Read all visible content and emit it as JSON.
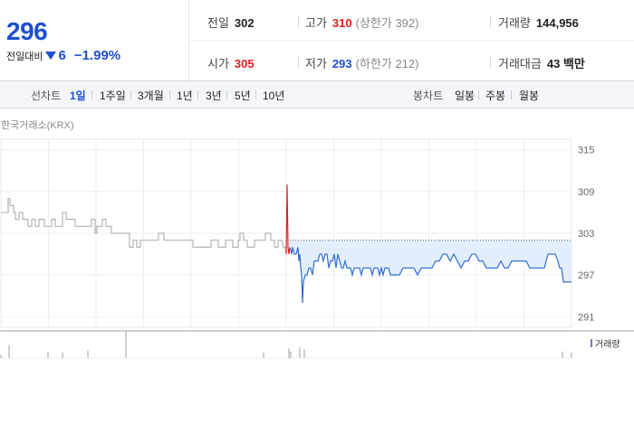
{
  "quote": {
    "price": "296",
    "change_label": "전일대비",
    "change_amount": "6",
    "change_rate": "−1.99%",
    "stats": [
      {
        "label": "전일",
        "value": "302",
        "sub": "",
        "tone": ""
      },
      {
        "label": "고가",
        "value": "310",
        "sub": "(상한가 392)",
        "tone": "up"
      },
      {
        "label": "거래량",
        "value": "144,956",
        "sub": "",
        "tone": ""
      },
      {
        "label": "시가",
        "value": "305",
        "sub": "",
        "tone": "up"
      },
      {
        "label": "저가",
        "value": "293",
        "sub": "(하한가 212)",
        "tone": "down"
      },
      {
        "label": "거래대금",
        "value": "43 백만",
        "sub": "",
        "tone": ""
      }
    ]
  },
  "periods": {
    "line_label": "선차트",
    "line_tabs": [
      "1일",
      "1주일",
      "3개월",
      "1년",
      "3년",
      "5년",
      "10년"
    ],
    "active": "1일",
    "candle_label": "봉차트",
    "candle_tabs": [
      "일봉",
      "주봉",
      "월봉"
    ]
  },
  "chart": {
    "exchange": "한국거래소(KRX)",
    "volume_legend": "거래량"
  },
  "chart_data": {
    "type": "line",
    "ylim": [
      290,
      316
    ],
    "y_ticks": [
      315,
      309,
      303,
      297,
      291
    ],
    "reference_price": 302,
    "series": [
      {
        "points": [
          [
            0,
            306
          ],
          [
            8,
            306
          ],
          [
            8,
            308
          ],
          [
            10,
            308
          ],
          [
            10,
            307
          ],
          [
            14,
            307
          ],
          [
            14,
            306
          ],
          [
            16,
            306
          ],
          [
            16,
            305
          ],
          [
            20,
            305
          ],
          [
            20,
            306
          ],
          [
            24,
            306
          ],
          [
            24,
            305
          ],
          [
            30,
            305
          ],
          [
            30,
            304
          ],
          [
            34,
            304
          ],
          [
            34,
            305
          ],
          [
            38,
            305
          ],
          [
            38,
            304
          ],
          [
            42,
            304
          ],
          [
            42,
            305
          ],
          [
            48,
            305
          ],
          [
            48,
            304
          ],
          [
            56,
            304
          ],
          [
            56,
            305
          ],
          [
            60,
            305
          ],
          [
            60,
            304
          ],
          [
            68,
            304
          ],
          [
            68,
            306
          ],
          [
            72,
            306
          ],
          [
            72,
            305
          ],
          [
            82,
            305
          ],
          [
            82,
            304
          ],
          [
            100,
            304
          ],
          [
            100,
            305
          ],
          [
            104,
            305
          ],
          [
            104,
            303
          ],
          [
            106,
            303
          ],
          [
            106,
            304
          ],
          [
            112,
            304
          ],
          [
            112,
            305
          ],
          [
            116,
            305
          ],
          [
            116,
            304
          ],
          [
            122,
            304
          ],
          [
            122,
            303
          ],
          [
            142,
            303
          ],
          [
            142,
            301
          ],
          [
            146,
            301
          ],
          [
            146,
            302
          ],
          [
            150,
            302
          ],
          [
            150,
            301
          ],
          [
            154,
            301
          ],
          [
            154,
            302
          ],
          [
            174,
            302
          ],
          [
            174,
            303
          ],
          [
            180,
            303
          ],
          [
            180,
            302
          ],
          [
            212,
            302
          ],
          [
            212,
            301
          ],
          [
            232,
            301
          ],
          [
            232,
            302
          ],
          [
            240,
            302
          ],
          [
            240,
            301
          ],
          [
            248,
            301
          ],
          [
            248,
            302
          ],
          [
            256,
            302
          ],
          [
            256,
            301
          ],
          [
            262,
            301
          ],
          [
            262,
            302
          ],
          [
            264,
            302
          ],
          [
            264,
            303
          ],
          [
            268,
            303
          ],
          [
            268,
            302
          ],
          [
            272,
            302
          ],
          [
            272,
            301
          ],
          [
            280,
            301
          ],
          [
            280,
            302
          ],
          [
            292,
            302
          ],
          [
            292,
            303
          ],
          [
            298,
            303
          ],
          [
            298,
            302
          ],
          [
            302,
            302
          ],
          [
            302,
            301
          ],
          [
            306,
            301
          ],
          [
            306,
            302
          ],
          [
            310,
            302
          ],
          [
            312,
            301
          ],
          [
            314,
            301
          ],
          [
            315,
            300
          ]
        ],
        "color": "#b3b3b3"
      },
      {
        "points": [
          [
            315,
            300
          ],
          [
            316,
            310
          ],
          [
            317,
            301
          ],
          [
            318,
            300
          ],
          [
            319,
            301
          ]
        ],
        "color": "#e02020"
      },
      {
        "points": [
          [
            319,
            301
          ],
          [
            321,
            300
          ],
          [
            322,
            301
          ],
          [
            324,
            300
          ],
          [
            326,
            300
          ],
          [
            328,
            301
          ],
          [
            329,
            299
          ],
          [
            330,
            300
          ],
          [
            331,
            298
          ],
          [
            332,
            297
          ],
          [
            333,
            293
          ],
          [
            334,
            296
          ],
          [
            336,
            297
          ],
          [
            338,
            297
          ],
          [
            340,
            298
          ],
          [
            342,
            298
          ],
          [
            344,
            297
          ],
          [
            346,
            299
          ],
          [
            348,
            299
          ],
          [
            350,
            299
          ],
          [
            352,
            300
          ],
          [
            354,
            300
          ],
          [
            356,
            299
          ],
          [
            358,
            300
          ],
          [
            360,
            300
          ],
          [
            362,
            298
          ],
          [
            364,
            299
          ],
          [
            366,
            299
          ],
          [
            368,
            300
          ],
          [
            370,
            298
          ],
          [
            372,
            300
          ],
          [
            374,
            299
          ],
          [
            376,
            298
          ],
          [
            378,
            298
          ],
          [
            380,
            299
          ],
          [
            382,
            298
          ],
          [
            384,
            298
          ],
          [
            386,
            298
          ],
          [
            388,
            297
          ],
          [
            390,
            298
          ],
          [
            392,
            298
          ],
          [
            396,
            298
          ],
          [
            398,
            297
          ],
          [
            400,
            298
          ],
          [
            402,
            298
          ],
          [
            404,
            298
          ],
          [
            406,
            298
          ],
          [
            408,
            298
          ],
          [
            410,
            297
          ],
          [
            412,
            298
          ],
          [
            414,
            298
          ],
          [
            416,
            298
          ],
          [
            418,
            297
          ],
          [
            420,
            298
          ],
          [
            422,
            297
          ],
          [
            424,
            298
          ],
          [
            426,
            298
          ],
          [
            428,
            298
          ],
          [
            430,
            297
          ],
          [
            432,
            297
          ],
          [
            436,
            297
          ],
          [
            440,
            297
          ],
          [
            444,
            298
          ],
          [
            448,
            298
          ],
          [
            452,
            298
          ],
          [
            456,
            298
          ],
          [
            460,
            297
          ],
          [
            464,
            298
          ],
          [
            468,
            298
          ],
          [
            472,
            298
          ],
          [
            476,
            298
          ],
          [
            480,
            299
          ],
          [
            484,
            299
          ],
          [
            488,
            300
          ],
          [
            492,
            300
          ],
          [
            496,
            299
          ],
          [
            500,
            300
          ],
          [
            504,
            299
          ],
          [
            508,
            298
          ],
          [
            512,
            299
          ],
          [
            516,
            299
          ],
          [
            520,
            300
          ],
          [
            524,
            300
          ],
          [
            528,
            299
          ],
          [
            532,
            299
          ],
          [
            536,
            298
          ],
          [
            540,
            298
          ],
          [
            544,
            298
          ],
          [
            548,
            298
          ],
          [
            552,
            299
          ],
          [
            556,
            298
          ],
          [
            560,
            298
          ],
          [
            564,
            299
          ],
          [
            568,
            299
          ],
          [
            572,
            299
          ],
          [
            576,
            299
          ],
          [
            580,
            299
          ],
          [
            584,
            298
          ],
          [
            588,
            298
          ],
          [
            592,
            298
          ],
          [
            596,
            298
          ],
          [
            600,
            298
          ],
          [
            604,
            300
          ],
          [
            608,
            300
          ],
          [
            612,
            300
          ],
          [
            615,
            299
          ],
          [
            617,
            298
          ],
          [
            619,
            298
          ],
          [
            621,
            296
          ],
          [
            623,
            296
          ],
          [
            630,
            296
          ]
        ],
        "color": "#2e6ed6"
      }
    ],
    "volume_bars": [
      [
        0,
        3
      ],
      [
        9,
        12
      ],
      [
        52,
        6
      ],
      [
        68,
        5
      ],
      [
        96,
        7
      ],
      [
        138,
        25
      ],
      [
        290,
        5
      ],
      [
        318,
        9
      ],
      [
        320,
        6
      ],
      [
        330,
        10
      ],
      [
        335,
        8
      ],
      [
        620,
        6
      ],
      [
        630,
        5
      ]
    ]
  }
}
